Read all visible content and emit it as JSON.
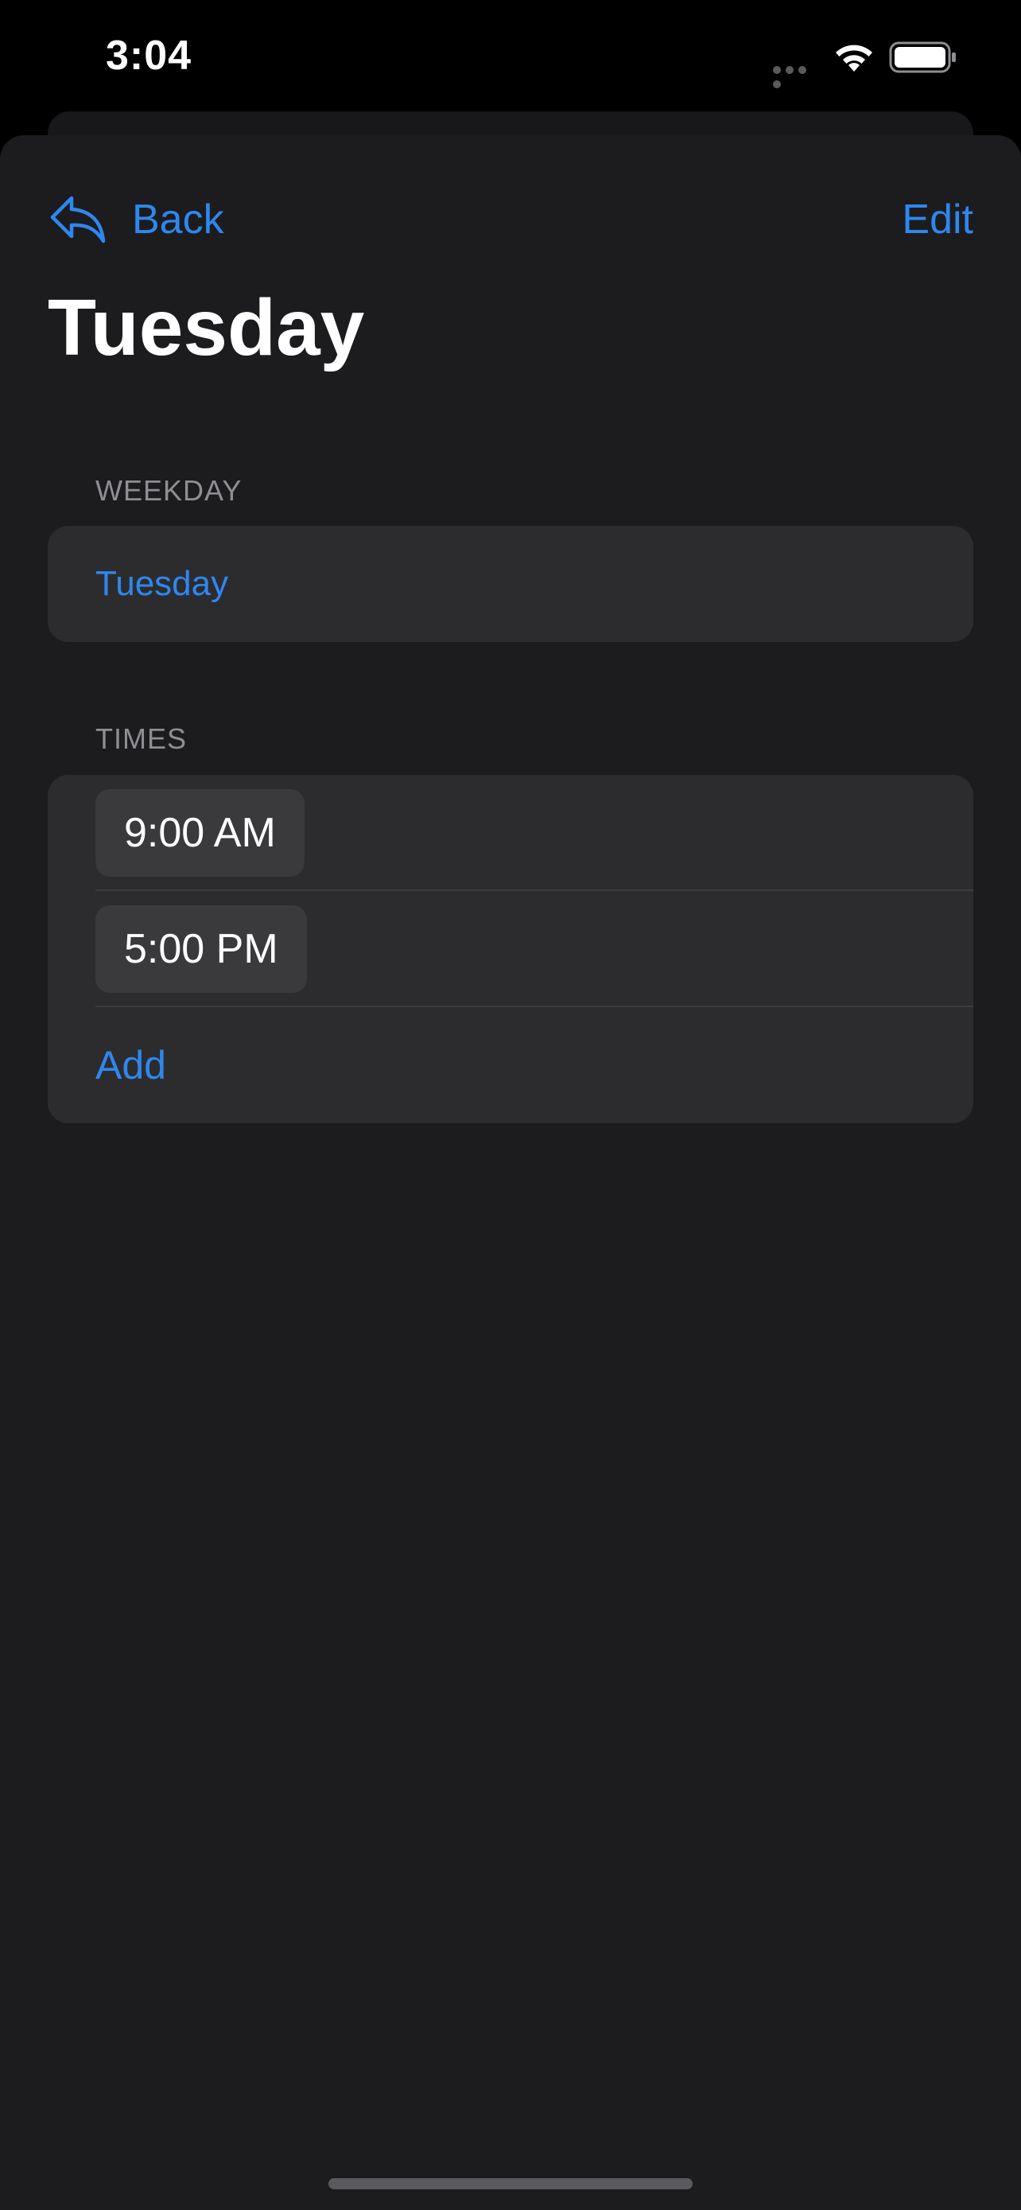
{
  "status_bar": {
    "time": "3:04"
  },
  "nav": {
    "back_label": "Back",
    "edit_label": "Edit"
  },
  "page": {
    "title": "Tuesday"
  },
  "weekday_section": {
    "header": "WEEKDAY",
    "value": "Tuesday"
  },
  "times_section": {
    "header": "TIMES",
    "times": [
      "9:00 AM",
      "5:00 PM"
    ],
    "add_label": "Add"
  },
  "colors": {
    "accent": "#2f87ef",
    "background": "#1c1c1e",
    "cell": "#2c2c2e",
    "pill": "#3a3a3c",
    "secondary_text": "#8e8e93"
  },
  "icons": {
    "back": "reply-arrow-icon",
    "signal": "cellular-signal-icon",
    "wifi": "wifi-icon",
    "battery": "battery-icon"
  }
}
